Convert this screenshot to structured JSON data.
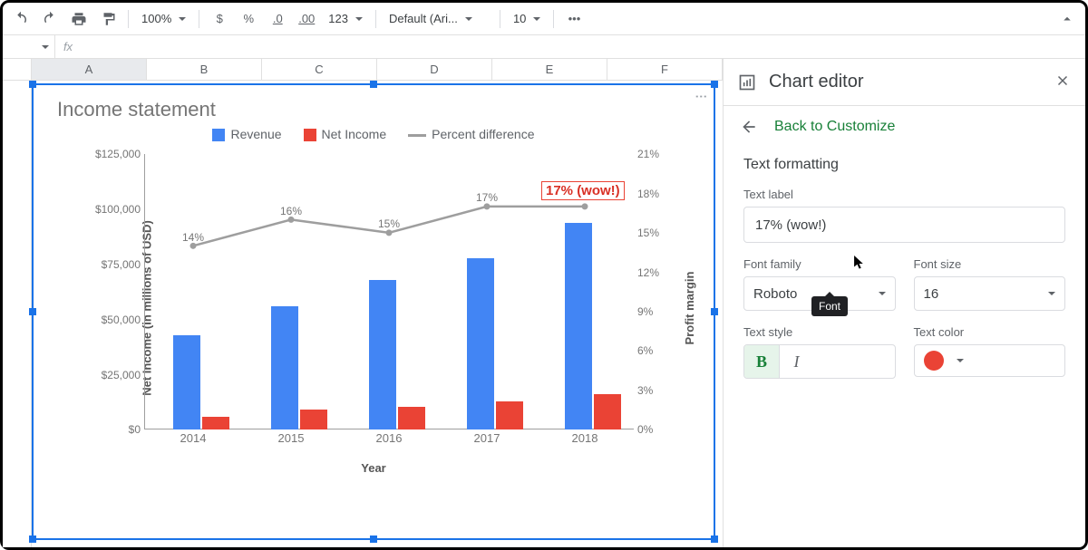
{
  "toolbar": {
    "zoom": "100%",
    "currency": "$",
    "percent": "%",
    "dec_dec": ".0",
    "inc_dec": ".00",
    "format123": "123",
    "font": "Default (Ari...",
    "font_size": "10",
    "more": "•••"
  },
  "formula_bar": {
    "cell_ref": "",
    "fx": "fx",
    "value": ""
  },
  "columns": [
    "A",
    "B",
    "C",
    "D",
    "E",
    "F"
  ],
  "columns_selected": "A",
  "chart_editor": {
    "title": "Chart editor",
    "back": "Back to Customize",
    "section": "Text formatting",
    "text_label_title": "Text label",
    "text_label_value": "17% (wow!)",
    "font_family_label": "Font family",
    "font_family_value": "Roboto",
    "font_size_label": "Font size",
    "font_size_value": "16",
    "text_style_label": "Text style",
    "bold": "B",
    "italic": "I",
    "text_color_label": "Text color",
    "tooltip": "Font",
    "text_color": "#ea4335"
  },
  "chart_data": {
    "type": "bar",
    "title": "Income statement",
    "xlabel": "Year",
    "ylabel_left": "Net Income (in millions of USD)",
    "ylabel_right": "Profit margin",
    "categories": [
      "2014",
      "2015",
      "2016",
      "2017",
      "2018"
    ],
    "y_left_ticks": [
      "$0",
      "$25,000",
      "$50,000",
      "$75,000",
      "$100,000",
      "$125,000"
    ],
    "y_left_lim": [
      0,
      125000
    ],
    "y_right_ticks": [
      "0%",
      "3%",
      "6%",
      "9%",
      "12%",
      "15%",
      "18%",
      "21%"
    ],
    "y_right_lim": [
      0,
      21
    ],
    "series": [
      {
        "name": "Revenue",
        "type": "bar",
        "color": "#4285f4",
        "values": [
          43000,
          56000,
          68000,
          78000,
          94000
        ]
      },
      {
        "name": "Net Income",
        "type": "bar",
        "color": "#ea4335",
        "values": [
          6000,
          9000,
          10500,
          13000,
          16000
        ]
      },
      {
        "name": "Percent difference",
        "type": "line",
        "color": "#9e9e9e",
        "axis": "right",
        "values": [
          14,
          16,
          15,
          17,
          17
        ],
        "labels": [
          "14%",
          "16%",
          "15%",
          "17%",
          ""
        ]
      }
    ],
    "annotation": {
      "text": "17% (wow!)",
      "x_index": 4
    }
  }
}
